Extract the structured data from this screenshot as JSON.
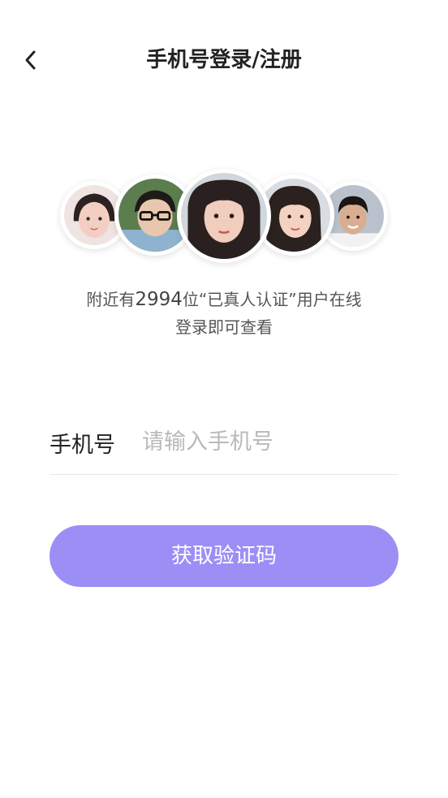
{
  "header": {
    "title": "手机号登录/注册"
  },
  "icons": {
    "back": "chevron-left-icon"
  },
  "avatars": [
    {
      "name": "user-avatar-1"
    },
    {
      "name": "user-avatar-2"
    },
    {
      "name": "user-avatar-3"
    },
    {
      "name": "user-avatar-4"
    },
    {
      "name": "user-avatar-5"
    }
  ],
  "online": {
    "prefix": "附近有",
    "count": "2994",
    "suffix": "位“已真人认证”用户在线",
    "line2": "登录即可查看"
  },
  "phone": {
    "label": "手机号",
    "value": "",
    "placeholder": "请输入手机号"
  },
  "actions": {
    "get_code": "获取验证码"
  },
  "colors": {
    "primary_button": "#9b8ff6",
    "button_text": "#ffffff",
    "placeholder": "#b9b9b9"
  }
}
